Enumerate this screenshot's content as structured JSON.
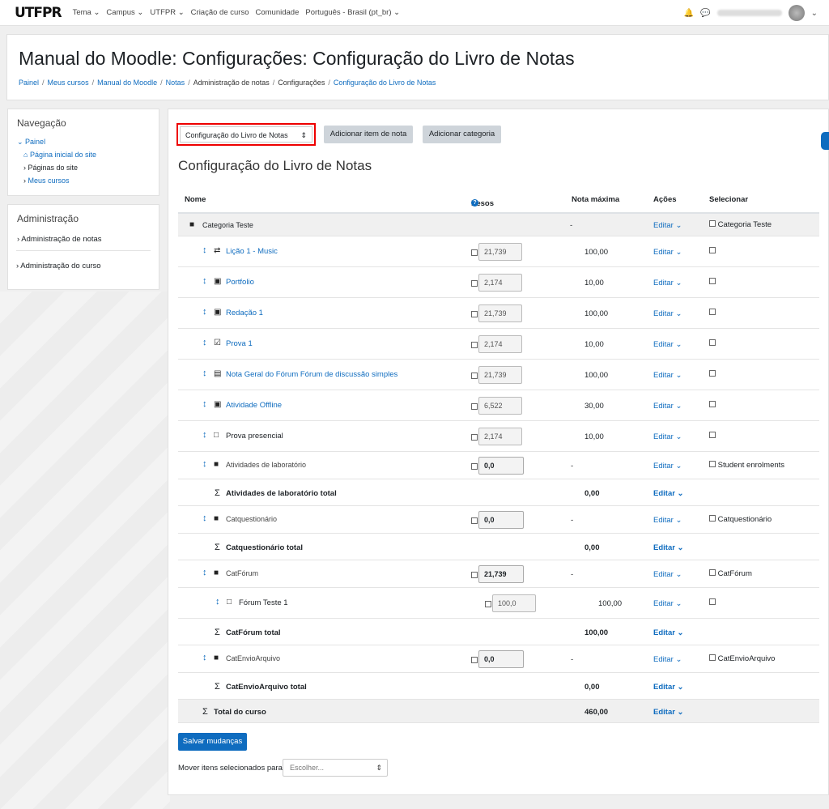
{
  "navbar": {
    "logo": "UTFPR",
    "links": [
      "Tema ⌄",
      "Campus ⌄",
      "UTFPR ⌄",
      "Criação de curso",
      "Comunidade",
      "Português - Brasil (pt_br) ⌄"
    ],
    "bell_icon": "bell-icon",
    "chat_icon": "chat-icon"
  },
  "header": {
    "title": "Manual do Moodle: Configurações: Configuração do Livro de Notas",
    "breadcrumbs": [
      "Painel",
      "Meus cursos",
      "Manual do Moodle",
      "Notas",
      "Administração de notas",
      "Configurações",
      "Configuração do Livro de Notas"
    ]
  },
  "navigation": {
    "title": "Navegação",
    "root": "Painel",
    "items": [
      "Página inicial do site",
      "Páginas do site",
      "Meus cursos"
    ]
  },
  "administration": {
    "title": "Administração",
    "items": [
      "Administração de notas",
      "Administração do curso"
    ]
  },
  "main": {
    "selector_value": "Configuração do Livro de Notas",
    "add_item_label": "Adicionar item de nota",
    "add_category_label": "Adicionar categoria",
    "heading": "Configuração do Livro de Notas",
    "columns": {
      "name": "Nome",
      "weights": "Pesos",
      "max": "Nota máxima",
      "actions": "Ações",
      "select": "Selecionar"
    },
    "edit_label": "Editar ⌄",
    "rows": [
      {
        "kind": "cat0",
        "icon": "folder-icon",
        "name": "Categoria Teste",
        "weight": "",
        "max": "-",
        "select": "Categoria Teste"
      },
      {
        "kind": "item",
        "icon": "lesson-icon",
        "name": "Lição 1 - Music",
        "weight": "21,739",
        "max": "100,00",
        "select": "",
        "link": true
      },
      {
        "kind": "item",
        "icon": "assign-icon",
        "name": "Portfolio",
        "weight": "2,174",
        "max": "10,00",
        "select": "",
        "link": true
      },
      {
        "kind": "item",
        "icon": "assign-icon",
        "name": "Redação 1",
        "weight": "21,739",
        "max": "100,00",
        "select": "",
        "link": true
      },
      {
        "kind": "item",
        "icon": "quiz-icon",
        "name": "Prova 1",
        "weight": "2,174",
        "max": "10,00",
        "select": "",
        "link": true
      },
      {
        "kind": "item",
        "icon": "forum-icon",
        "name": "Nota Geral do Fórum Fórum de discussão simples",
        "weight": "21,739",
        "max": "100,00",
        "select": "",
        "link": true
      },
      {
        "kind": "item",
        "icon": "assign-icon",
        "name": "Atividade Offline",
        "weight": "6,522",
        "max": "30,00",
        "select": "",
        "link": true
      },
      {
        "kind": "item",
        "icon": "manual-icon",
        "name": "Prova presencial",
        "weight": "2,174",
        "max": "10,00",
        "select": "",
        "link": false
      },
      {
        "kind": "cat",
        "icon": "folder-icon",
        "name": "Atividades de laboratório",
        "weight": "0,0",
        "max": "-",
        "select": "Student enrolments"
      },
      {
        "kind": "total",
        "name": "Atividades de laboratório total",
        "max": "0,00"
      },
      {
        "kind": "cat",
        "icon": "folder-icon",
        "name": "Catquestionário",
        "weight": "0,0",
        "max": "-",
        "select": "Catquestionário"
      },
      {
        "kind": "total",
        "name": "Catquestionário total",
        "max": "0,00"
      },
      {
        "kind": "cat",
        "icon": "folder-icon",
        "name": "CatFórum",
        "weight": "21,739",
        "max": "-",
        "select": "CatFórum"
      },
      {
        "kind": "sub",
        "icon": "manual-icon",
        "name": "Fórum Teste 1",
        "weight": "100,0",
        "max": "100,00",
        "select": ""
      },
      {
        "kind": "total",
        "name": "CatFórum total",
        "max": "100,00"
      },
      {
        "kind": "cat",
        "icon": "folder-icon",
        "name": "CatEnvioArquivo",
        "weight": "0,0",
        "max": "-",
        "select": "CatEnvioArquivo"
      },
      {
        "kind": "total",
        "name": "CatEnvioArquivo total",
        "max": "0,00"
      },
      {
        "kind": "course",
        "name": "Total do curso",
        "max": "460,00"
      }
    ],
    "save_label": "Salvar mudanças",
    "move_label": "Mover itens selecionados para",
    "move_placeholder": "Escolher..."
  }
}
